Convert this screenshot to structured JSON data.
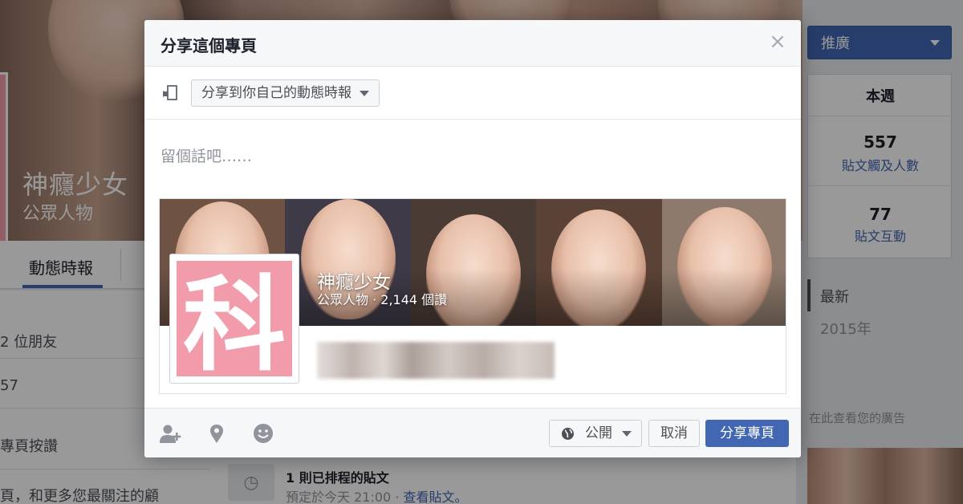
{
  "background_page": {
    "page_name": "神癮少女",
    "page_category": "公眾人物",
    "tab_timeline": "動態時報",
    "left_lines": [
      "2 位朋友",
      "57",
      "專頁按讚",
      "頁，和更多您最關注的顧"
    ],
    "promote_label": "推廣",
    "stats_header": "本週",
    "stat_reach_value": "557",
    "stat_reach_label": "貼文觸及人數",
    "stat_engagement_value": "77",
    "stat_engagement_label": "貼文互動",
    "timeline_latest": "最新",
    "timeline_year": "2015年",
    "ads_label": "在此查看您的廣告",
    "scheduled_title": "1 則已排程的貼文",
    "scheduled_sub": "預定於今天 21:00 · ",
    "scheduled_link": "查看貼文。"
  },
  "dialog": {
    "title": "分享這個專頁",
    "close_symbol": "×",
    "share_target": "分享到你自己的動態時報",
    "composer_placeholder": "留個話吧……",
    "preview": {
      "page_name": "神癮少女",
      "page_meta": "公眾人物 · 2,144 個讚",
      "logo_char": "科"
    },
    "footer": {
      "audience": "公開",
      "cancel": "取消",
      "share": "分享專頁"
    }
  },
  "colors": {
    "accent": "#4267b2",
    "logo_pink": "#f29cab"
  },
  "icons": {
    "share_target": "share-target-icon",
    "tag_friends": "tag-friend-icon",
    "location": "location-pin-icon",
    "feeling": "smiley-icon",
    "audience": "globe-icon"
  }
}
